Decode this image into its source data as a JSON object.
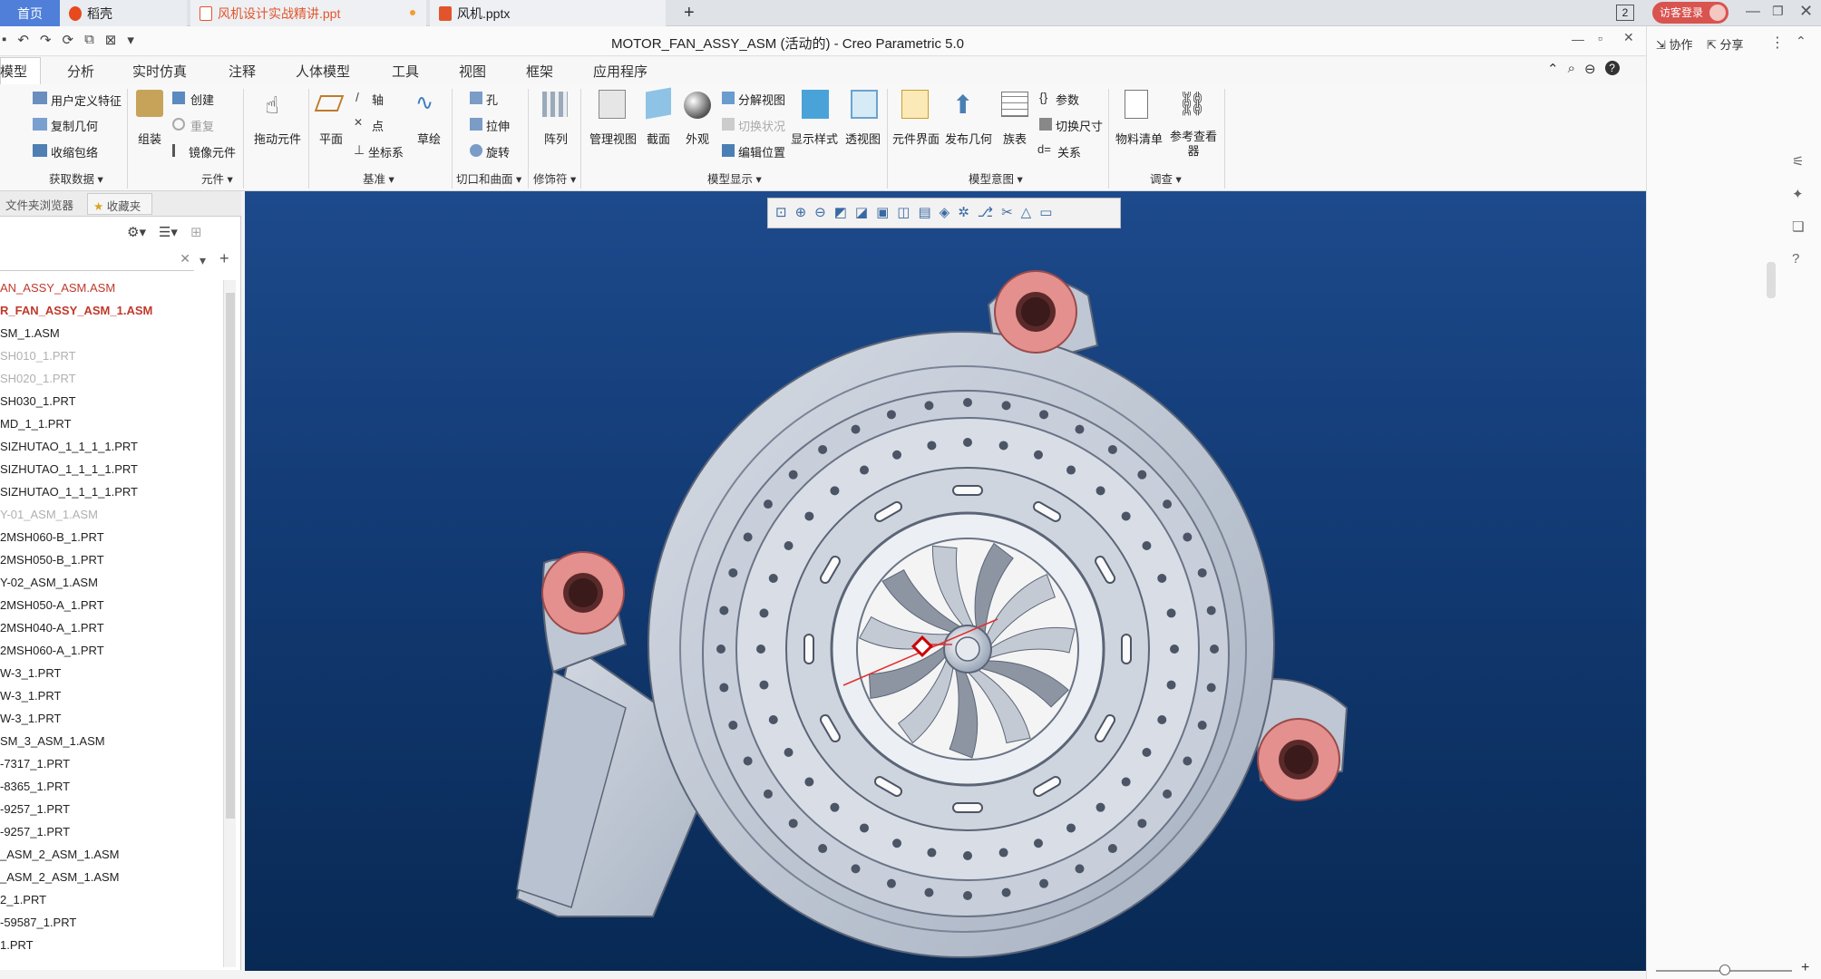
{
  "tabs": {
    "home": "首页",
    "daoke": "稻壳",
    "ppt1": "风机设计实战精讲.ppt",
    "ppt2": "风机.pptx",
    "new_tab": "+",
    "badge": "2",
    "login": "访客登录"
  },
  "window": {
    "title": "MOTOR_FAN_ASSY_ASM (活动的) - Creo Parametric 5.0"
  },
  "ribbon_tabs": [
    "模型",
    "分析",
    "实时仿真",
    "注释",
    "人体模型",
    "工具",
    "视图",
    "框架",
    "应用程序"
  ],
  "ribbon": {
    "user_feature": "用户定义特征",
    "copy_geom": "复制几何",
    "shrinkwrap": "收缩包络",
    "assemble": "组装",
    "create": "创建",
    "repeat": "重复",
    "mirror": "镜像元件",
    "drag": "拖动元件",
    "plane": "平面",
    "axis": "轴",
    "point": "点",
    "csys": "坐标系",
    "sketch": "草绘",
    "hole": "孔",
    "extrude": "拉伸",
    "revolve": "旋转",
    "pattern": "阵列",
    "manage_views": "管理视图",
    "section": "截面",
    "appearance": "外观",
    "explode": "分解视图",
    "toggle_state": "切换状况",
    "edit_pos": "编辑位置",
    "display_style": "显示样式",
    "perspective": "透视图",
    "comp_interface": "元件界面",
    "publish_geom": "发布几何",
    "family_table": "族表",
    "params": "参数",
    "switch_dims": "切换尺寸",
    "relations": "关系",
    "bom": "物料清单",
    "ref_viewer": "参考查看器",
    "groups": {
      "get_data": "获取数据",
      "component": "元件",
      "datum": "基准",
      "cut_surface": "切口和曲面",
      "modifiers": "修饰符",
      "model_display": "模型显示",
      "model_intent": "模型意图",
      "investigate": "调查"
    }
  },
  "left_panel": {
    "tab1": "文件夹浏览器",
    "tab2": "收藏夹",
    "tree": [
      {
        "label": "AN_ASSY_ASM.ASM",
        "style": "red"
      },
      {
        "label": "R_FAN_ASSY_ASM_1.ASM",
        "style": "redbold"
      },
      {
        "label": "SM_1.ASM",
        "style": "normal"
      },
      {
        "label": "SH010_1.PRT",
        "style": "grey"
      },
      {
        "label": "SH020_1.PRT",
        "style": "grey"
      },
      {
        "label": "SH030_1.PRT",
        "style": "normal"
      },
      {
        "label": "MD_1_1.PRT",
        "style": "normal"
      },
      {
        "label": "SIZHUTAO_1_1_1_1.PRT",
        "style": "normal"
      },
      {
        "label": "SIZHUTAO_1_1_1_1.PRT",
        "style": "normal"
      },
      {
        "label": "SIZHUTAO_1_1_1_1.PRT",
        "style": "normal"
      },
      {
        "label": "Y-01_ASM_1.ASM",
        "style": "grey"
      },
      {
        "label": "2MSH060-B_1.PRT",
        "style": "normal"
      },
      {
        "label": "2MSH050-B_1.PRT",
        "style": "normal"
      },
      {
        "label": "Y-02_ASM_1.ASM",
        "style": "normal"
      },
      {
        "label": "2MSH050-A_1.PRT",
        "style": "normal"
      },
      {
        "label": "2MSH040-A_1.PRT",
        "style": "normal"
      },
      {
        "label": "2MSH060-A_1.PRT",
        "style": "normal"
      },
      {
        "label": "W-3_1.PRT",
        "style": "normal"
      },
      {
        "label": "W-3_1.PRT",
        "style": "normal"
      },
      {
        "label": "W-3_1.PRT",
        "style": "normal"
      },
      {
        "label": "SM_3_ASM_1.ASM",
        "style": "normal"
      },
      {
        "label": "-7317_1.PRT",
        "style": "normal"
      },
      {
        "label": "-8365_1.PRT",
        "style": "normal"
      },
      {
        "label": "-9257_1.PRT",
        "style": "normal"
      },
      {
        "label": "-9257_1.PRT",
        "style": "normal"
      },
      {
        "label": "_ASM_2_ASM_1.ASM",
        "style": "normal"
      },
      {
        "label": "_ASM_2_ASM_1.ASM",
        "style": "normal"
      },
      {
        "label": "2_1.PRT",
        "style": "normal"
      },
      {
        "label": "-59587_1.PRT",
        "style": "normal"
      },
      {
        "label": "1.PRT",
        "style": "normal"
      }
    ]
  },
  "right_panel": {
    "collab": "协作",
    "share": "分享"
  },
  "colors": {
    "viewport_top": "#1d4a8c",
    "viewport_bottom": "#082954",
    "model_body": "#c3cbd8",
    "boss_pink": "#e59a98",
    "tree_red": "#c0392b"
  }
}
